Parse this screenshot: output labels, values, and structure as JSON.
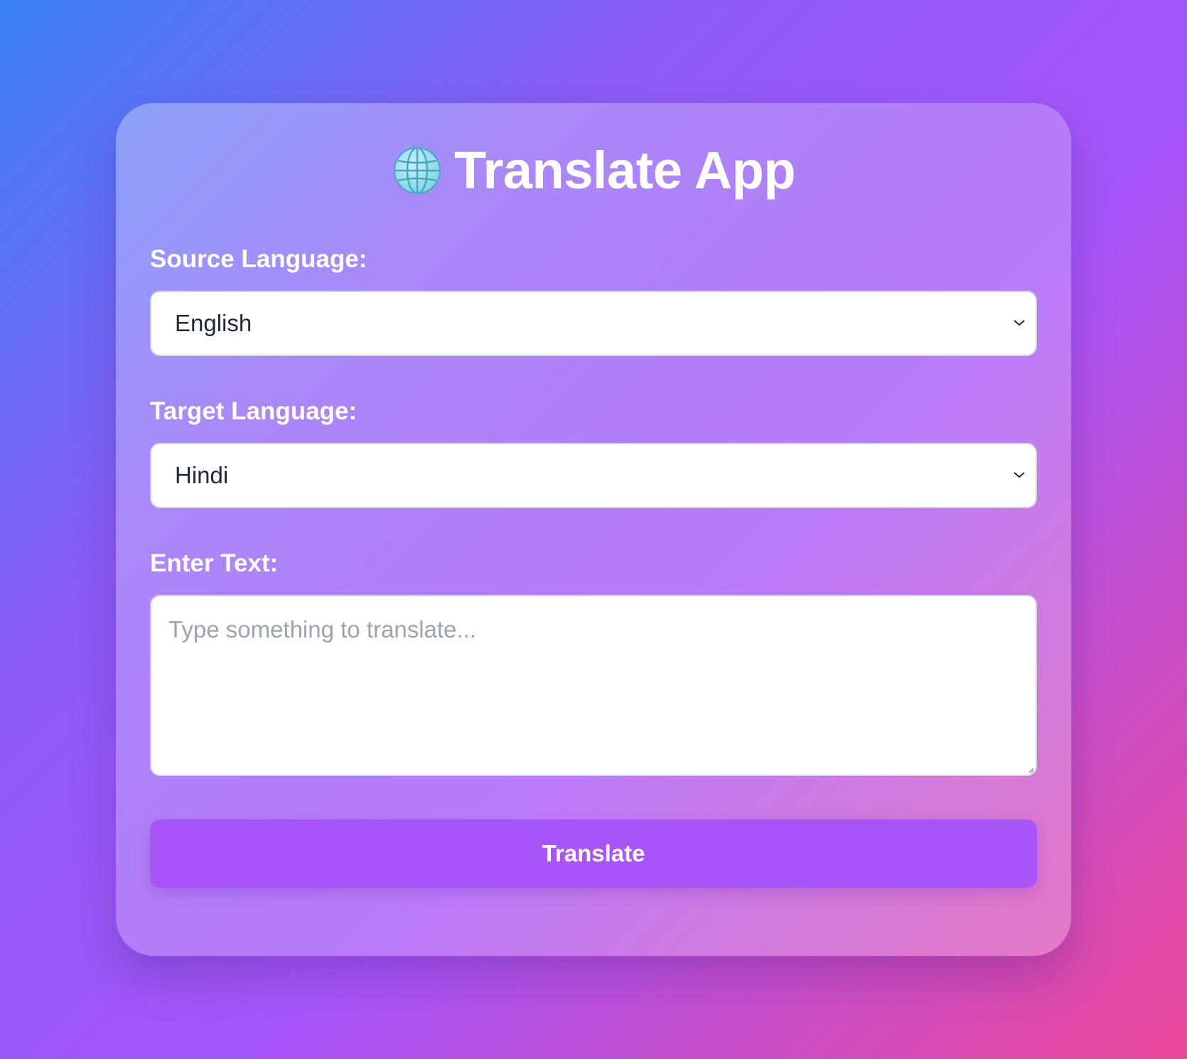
{
  "app": {
    "title": "Translate App",
    "icon": "globe-icon"
  },
  "form": {
    "source_label": "Source Language:",
    "source_value": "English",
    "target_label": "Target Language:",
    "target_value": "Hindi",
    "text_label": "Enter Text:",
    "text_placeholder": "Type something to translate...",
    "text_value": ""
  },
  "actions": {
    "translate_label": "Translate"
  },
  "colors": {
    "accent": "#a855f7",
    "text_dark": "#1f2937",
    "placeholder": "#9ca3af"
  }
}
